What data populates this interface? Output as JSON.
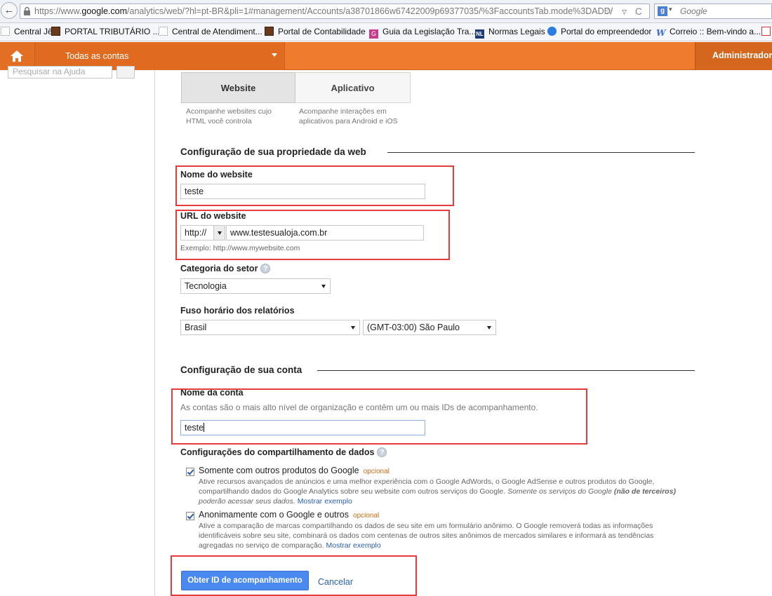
{
  "browser": {
    "url_prefix": "https://www.",
    "url_domain": "google.com",
    "url_rest": "/analytics/web/?hl=pt-BR&pli=1#management/Accounts/a38701866w67422009p69377035/%3FaccountsTab.mode%3DADD/",
    "url_icons": "☆ ▿ C",
    "search_placeholder": "Google",
    "search_engine_icon": "g-icon",
    "bookmarks": [
      {
        "label": "Central Jê",
        "icon": "blank"
      },
      {
        "label": "PORTAL TRIBUTÁRIO ...",
        "icon": "brown"
      },
      {
        "label": "Central de Atendiment...",
        "icon": "blank"
      },
      {
        "label": "Portal de Contabilidade",
        "icon": "brown"
      },
      {
        "label": "Guia da Legislação Tra...",
        "icon": "pink"
      },
      {
        "label": "Normas Legais",
        "icon": "nl"
      },
      {
        "label": "Portal do empreendedor",
        "icon": "globe"
      },
      {
        "label": "Correio :: Bem-vindo a...",
        "icon": "w"
      },
      {
        "label": "",
        "icon": "mail"
      }
    ]
  },
  "appbar": {
    "account_selector": "Todas as contas",
    "admin_tab": "Administrador"
  },
  "sidebar": {
    "help_search_placeholder": "Pesquisar na Ajuda"
  },
  "tracking_type": {
    "website_label": "Website",
    "website_desc_1": "Acompanhe websites cujo",
    "website_desc_2": "HTML você controla",
    "app_label": "Aplicativo",
    "app_desc_1": "Acompanhe interações em",
    "app_desc_2": "aplicativos para Android e iOS"
  },
  "property": {
    "section_title": "Configuração de sua propriedade da web",
    "website_name_label": "Nome do website",
    "website_name_value": "teste",
    "website_url_label": "URL do website",
    "protocol_value": "http://",
    "url_value": "www.testesualoja.com.br",
    "url_example": "Exemplo: http://www.mywebsite.com",
    "industry_label": "Categoria do setor",
    "industry_value": "Tecnologia",
    "timezone_label": "Fuso horário dos relatórios",
    "country_value": "Brasil",
    "timezone_value": "(GMT-03:00) São Paulo",
    "help_mark": "?"
  },
  "account": {
    "section_title": "Configuração de sua conta",
    "name_label": "Nome da conta",
    "name_desc": "As contas são o mais alto nível de organização e contêm um ou mais IDs de acompanhamento.",
    "name_value": "teste"
  },
  "sharing": {
    "title": "Configurações do compartilhamento de dados",
    "options": [
      {
        "checked": true,
        "title": "Somente com outros produtos do Google",
        "tag": "opcional",
        "desc_1": "Ative recursos avançados de anúncios e uma melhor experiência com o Google AdWords, o Google AdSense e outros produtos do Google,",
        "desc_2": "compartilhando dados do Google Analytics sobre seu website com outros serviços do Google. ",
        "desc_2_italic": "Somente os serviços do Google ",
        "desc_2_bold": "(não de terceiros)",
        "desc_3_italic": "poderão acessar seus dados.",
        "link": "Mostrar exemplo"
      },
      {
        "checked": true,
        "title": "Anonimamente com o Google e outros",
        "tag": "opcional",
        "desc_1": "Ative a comparação de marcas compartilhando os dados de seu site em um formulário anônimo. O Google removerá todas as informações",
        "desc_2": "identificáveis sobre seu site, combinará os dados com centenas de outros sites anônimos de mercados similares e informará as tendências",
        "desc_3": "agregadas no serviço de comparação.",
        "link": "Mostrar exemplo"
      }
    ]
  },
  "actions": {
    "submit_label": "Obter ID de acompanhamento",
    "cancel_label": "Cancelar"
  },
  "colors": {
    "appbar": "#ef7b2f",
    "primary_button": "#4a8af0",
    "annotation_box": "#e53b3b",
    "link": "#2a5db0"
  }
}
